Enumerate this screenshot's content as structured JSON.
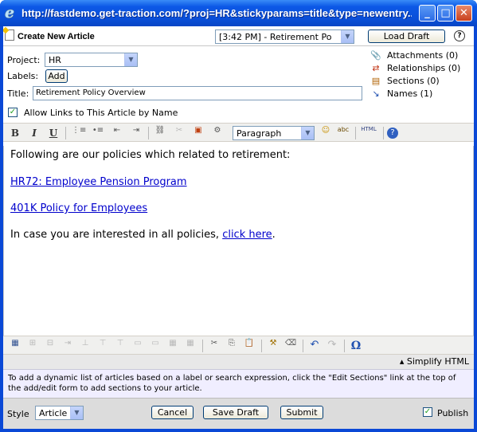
{
  "window": {
    "title": "http://fastdemo.get-traction.com/?proj=HR&stickyparams=title&type=newentry...",
    "ie_icon": "e",
    "controls": {
      "minimize": "_",
      "maximize": "□",
      "close": "✕"
    },
    "icon": "internet-explorer-icon"
  },
  "header": {
    "title": "Create New Article",
    "draft_select": "[3:42 PM] - Retirement Po",
    "load_draft_label": "Load Draft",
    "help": "?"
  },
  "form": {
    "project_label": "Project:",
    "project_value": "HR",
    "labels_label": "Labels:",
    "labels_add": "Add",
    "title_label": "Title:",
    "title_value": "Retirement Policy Overview",
    "allow_links_label": "Allow Links to This Article by Name",
    "allow_links_checked": true
  },
  "side_panel": [
    {
      "icon": "paperclip-icon",
      "glyph": "📎",
      "label": "Attachments (0)"
    },
    {
      "icon": "relationships-icon",
      "glyph": "⇄",
      "label": "Relationships (0)"
    },
    {
      "icon": "sections-icon",
      "glyph": "▤",
      "label": "Sections (0)"
    },
    {
      "icon": "names-icon",
      "glyph": "↘",
      "label": "Names (1)"
    }
  ],
  "format_select": "Paragraph",
  "format_glyphs": {
    "bold": "B",
    "italic": "I",
    "underline": "U",
    "ordered_list": "⋮≡",
    "unordered_list": "•≡",
    "outdent": "⇤",
    "indent": "⇥",
    "link": "⛓",
    "unlink": "✂",
    "image": "▣",
    "spell": "⚙",
    "emoji": "☺",
    "spellcheck": "abc",
    "html": "HTML",
    "help": "?"
  },
  "table_glyphs": {
    "insert_table": "▦",
    "cut": "✂",
    "copy": "⎘",
    "paste": "📋",
    "clean": "⚒",
    "eraser": "⌫",
    "undo": "↶",
    "redo": "↷",
    "special_char": "Ω"
  },
  "editor": {
    "intro": "Following are our policies which related to retirement:",
    "link1": "HR72: Employee Pension Program",
    "link2": "401K Policy for Employees",
    "outro_prefix": "In case you are interested in all policies, ",
    "outro_link": "click here",
    "outro_suffix": "."
  },
  "simplify_label": "▴ Simplify HTML",
  "tip": "To add a dynamic list of articles based on a label or search expression, click the \"Edit Sections\" link at the top of the add/edit form to add sections to your article.",
  "footer": {
    "style_label": "Style",
    "style_value": "Article",
    "cancel_label": "Cancel",
    "save_draft_label": "Save Draft",
    "submit_label": "Submit",
    "publish_label": "Publish",
    "publish_checked": true
  },
  "colors": {
    "titlebar": "#0a4fd9",
    "link": "#0000cc",
    "tip_bg": "#f0eeff"
  }
}
